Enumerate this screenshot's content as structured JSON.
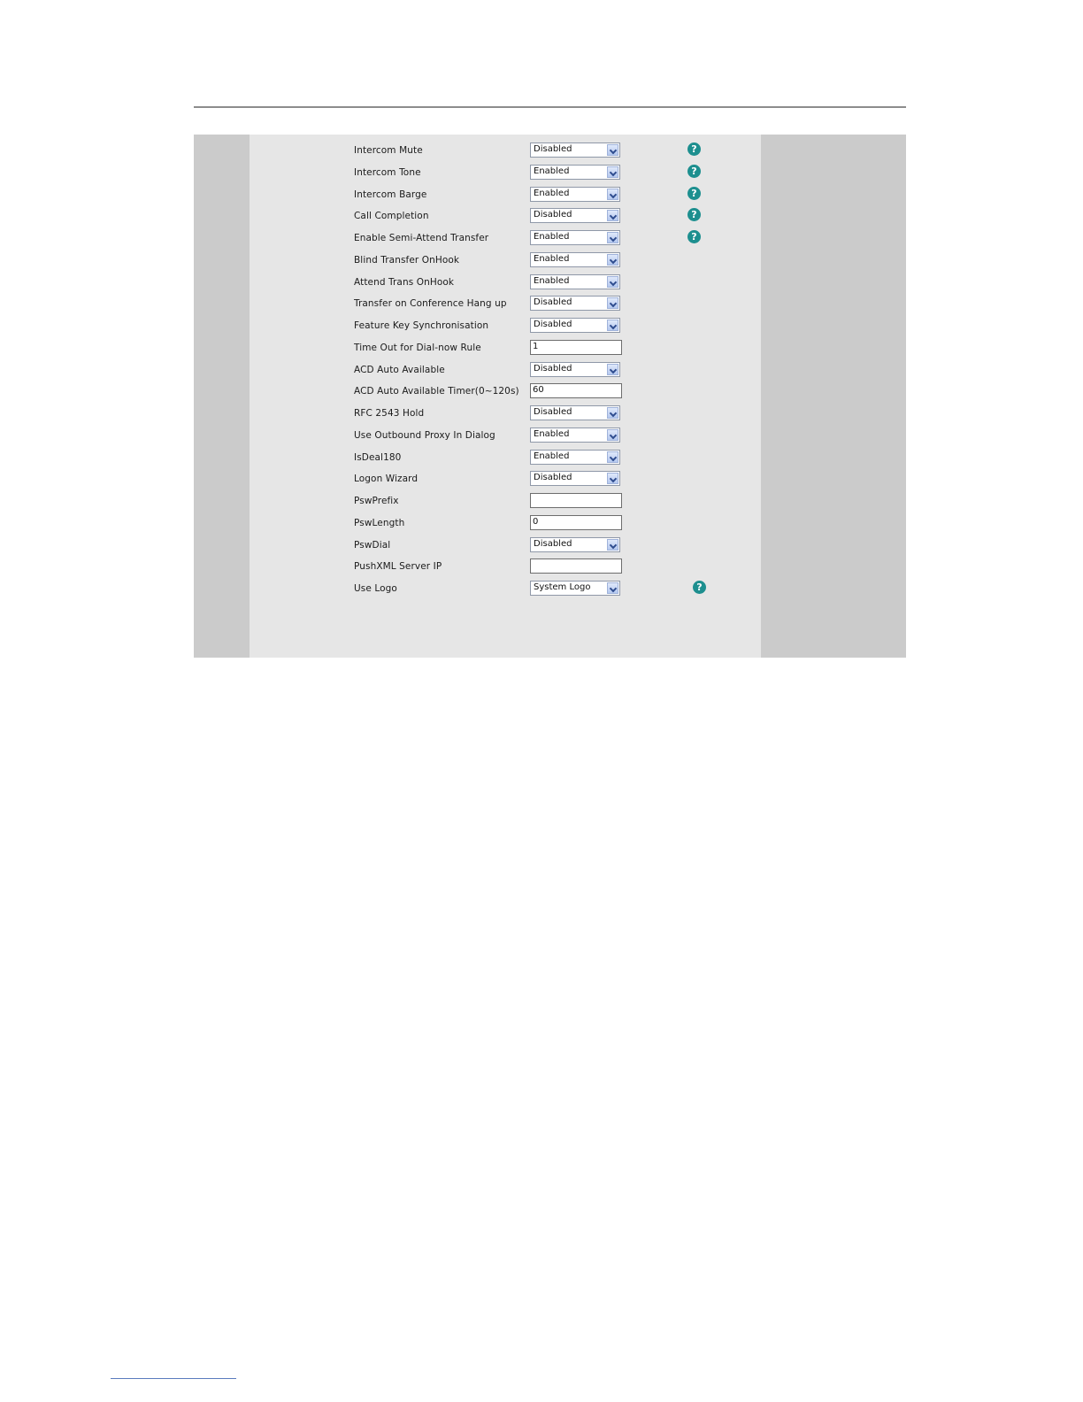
{
  "rows": [
    {
      "label": "Intercom Mute",
      "type": "select",
      "value": "Disabled",
      "help": true
    },
    {
      "label": "Intercom Tone",
      "type": "select",
      "value": "Enabled",
      "help": true
    },
    {
      "label": "Intercom Barge",
      "type": "select",
      "value": "Enabled",
      "help": true
    },
    {
      "label": "Call Completion",
      "type": "select",
      "value": "Disabled",
      "help": true
    },
    {
      "label": "Enable Semi-Attend Transfer",
      "type": "select",
      "value": "Enabled",
      "help": true
    },
    {
      "label": "Blind Transfer OnHook",
      "type": "select",
      "value": "Enabled",
      "help": false
    },
    {
      "label": "Attend Trans OnHook",
      "type": "select",
      "value": "Enabled",
      "help": false
    },
    {
      "label": "Transfer on Conference Hang up",
      "type": "select",
      "value": "Disabled",
      "help": false
    },
    {
      "label": "Feature Key Synchronisation",
      "type": "select",
      "value": "Disabled",
      "help": false
    },
    {
      "label": "Time Out for Dial-now Rule",
      "type": "text",
      "value": "1",
      "help": false
    },
    {
      "label": "ACD Auto Available",
      "type": "select",
      "value": "Disabled",
      "help": false
    },
    {
      "label": "ACD Auto Available Timer(0~120s)",
      "type": "text",
      "value": "60",
      "help": false
    },
    {
      "label": "RFC 2543 Hold",
      "type": "select",
      "value": "Disabled",
      "help": false
    },
    {
      "label": "Use Outbound Proxy In Dialog",
      "type": "select",
      "value": "Enabled",
      "help": false
    },
    {
      "label": "IsDeal180",
      "type": "select",
      "value": "Enabled",
      "help": false
    },
    {
      "label": "Logon Wizard",
      "type": "select",
      "value": "Disabled",
      "help": false
    },
    {
      "label": "PswPrefix",
      "type": "text",
      "value": "",
      "help": false
    },
    {
      "label": "PswLength",
      "type": "text",
      "value": "0",
      "help": false
    },
    {
      "label": "PswDial",
      "type": "select",
      "value": "Disabled",
      "help": false
    },
    {
      "label": "PushXML Server IP",
      "type": "text",
      "value": "",
      "help": false
    },
    {
      "label": "Use Logo",
      "type": "select",
      "value": "System Logo",
      "help": true
    }
  ],
  "help_glyph": "?",
  "colors": {
    "help_icon": "#1d8f8f",
    "panel": "#e6e6e6",
    "side": "#cbcbcb"
  }
}
